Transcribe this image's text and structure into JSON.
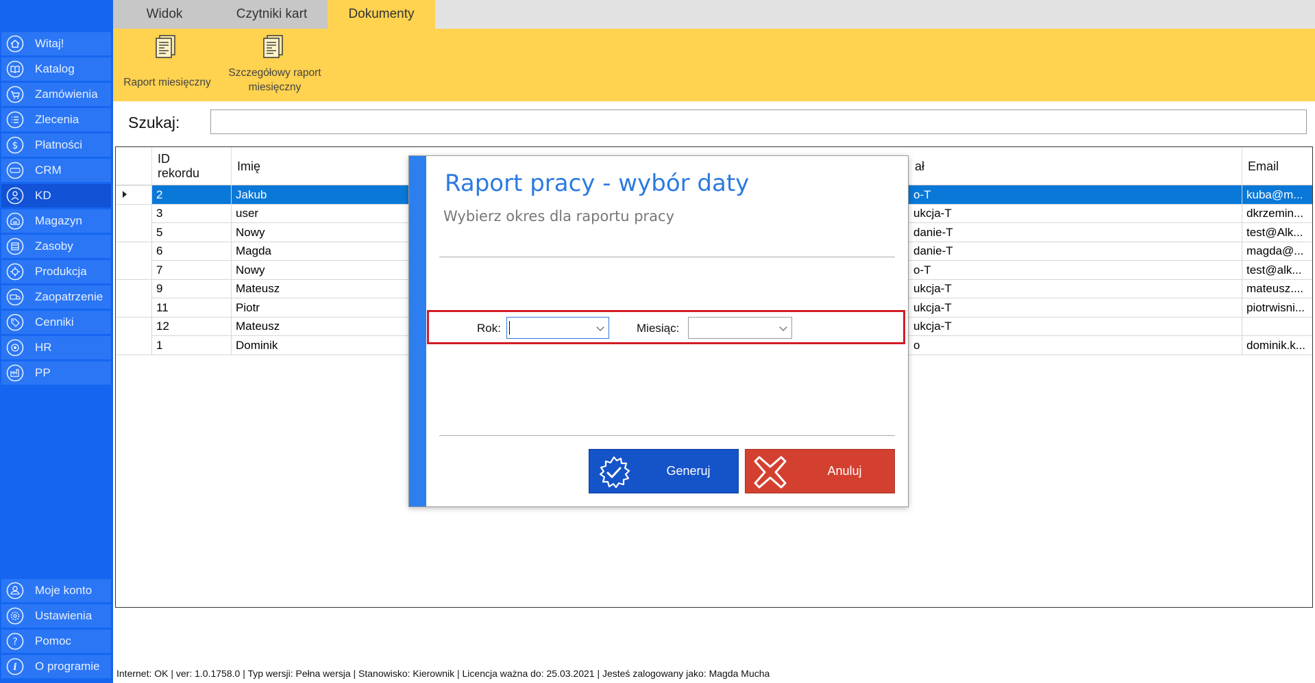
{
  "sidebar": {
    "items": [
      {
        "label": "Witaj!",
        "icon": "home-icon"
      },
      {
        "label": "Katalog",
        "icon": "book-icon"
      },
      {
        "label": "Zamówienia",
        "icon": "cart-icon"
      },
      {
        "label": "Zlecenia",
        "icon": "list-icon"
      },
      {
        "label": "Płatności",
        "icon": "dollar-icon"
      },
      {
        "label": "CRM",
        "icon": "crm-icon"
      },
      {
        "label": "KD",
        "icon": "person-icon"
      },
      {
        "label": "Magazyn",
        "icon": "warehouse-icon"
      },
      {
        "label": "Zasoby",
        "icon": "resources-icon"
      },
      {
        "label": "Produkcja",
        "icon": "production-icon"
      },
      {
        "label": "Zaopatrzenie",
        "icon": "truck-icon"
      },
      {
        "label": "Cenniki",
        "icon": "tag-icon"
      },
      {
        "label": "HR",
        "icon": "hr-icon"
      },
      {
        "label": "PP",
        "icon": "factory-icon"
      }
    ],
    "bottom_items": [
      {
        "label": "Moje konto",
        "icon": "account-icon"
      },
      {
        "label": "Ustawienia",
        "icon": "gear-icon"
      },
      {
        "label": "Pomoc",
        "icon": "help-icon"
      },
      {
        "label": "O programie",
        "icon": "info-icon"
      }
    ],
    "active": "KD"
  },
  "tabs": [
    {
      "label": "Widok"
    },
    {
      "label": "Czytniki kart"
    },
    {
      "label": "Dokumenty"
    }
  ],
  "active_tab": "Dokumenty",
  "ribbon": {
    "monthly_report": "Raport miesięczny",
    "detailed_report_line1": "Szczegółowy raport",
    "detailed_report_line2": "miesięczny"
  },
  "search": {
    "label": "Szukaj:",
    "value": ""
  },
  "grid": {
    "columns": {
      "id_line1": "ID",
      "id_line2": "rekordu",
      "name": "Imię",
      "dept_partial": "ał",
      "email": "Email"
    },
    "rows": [
      {
        "id": "2",
        "name": "Jakub",
        "dept": "o-T",
        "email": "kuba@m..."
      },
      {
        "id": "3",
        "name": "user",
        "dept": "ukcja-T",
        "email": "dkrzemin..."
      },
      {
        "id": "5",
        "name": "Nowy",
        "dept": "danie-T",
        "email": "test@Alk..."
      },
      {
        "id": "6",
        "name": "Magda",
        "dept": "danie-T",
        "email": "magda@..."
      },
      {
        "id": "7",
        "name": "Nowy",
        "dept": "o-T",
        "email": "test@alk..."
      },
      {
        "id": "9",
        "name": "Mateusz",
        "dept": "ukcja-T",
        "email": "mateusz...."
      },
      {
        "id": "11",
        "name": "Piotr",
        "dept": "ukcja-T",
        "email": "piotrwisni..."
      },
      {
        "id": "12",
        "name": "Mateusz",
        "dept": "ukcja-T",
        "email": ""
      },
      {
        "id": "1",
        "name": "Dominik",
        "dept": "o",
        "email": "dominik.k..."
      }
    ],
    "selected_index": 0
  },
  "dialog": {
    "title": "Raport pracy - wybór daty",
    "subtitle": "Wybierz okres dla raportu pracy",
    "year_label": "Rok:",
    "year_value": "",
    "month_label": "Miesiąc:",
    "month_value": "",
    "generate_label": "Generuj",
    "cancel_label": "Anuluj"
  },
  "status": {
    "text": "Internet: OK  |   ver: 1.0.1758.0   |   Typ wersji: Pełna wersja   |   Stanowisko: Kierownik   |   Licencja ważna do: 25.03.2021   |   Jesteś zalogowany jako: Magda Mucha"
  },
  "colors": {
    "sidebar": "#1565f0",
    "ribbon": "#ffd24f",
    "selection": "#0a78d8",
    "dialog_accent": "#2d7ff0",
    "generate": "#1553c9",
    "cancel": "#d4402f",
    "highlight_border": "#d21c27"
  }
}
